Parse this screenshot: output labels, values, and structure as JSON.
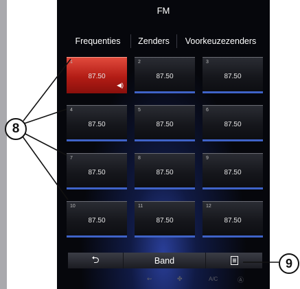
{
  "screen": {
    "title": "FM",
    "tabs": [
      "Frequenties",
      "Zenders",
      "Voorkeuzezenders"
    ]
  },
  "presets": [
    {
      "number": "1",
      "frequency": "87.50",
      "active": true,
      "playing_icon": "speaker-icon"
    },
    {
      "number": "2",
      "frequency": "87.50",
      "active": false
    },
    {
      "number": "3",
      "frequency": "87.50",
      "active": false
    },
    {
      "number": "4",
      "frequency": "87.50",
      "active": false
    },
    {
      "number": "5",
      "frequency": "87.50",
      "active": false
    },
    {
      "number": "6",
      "frequency": "87.50",
      "active": false
    },
    {
      "number": "7",
      "frequency": "87.50",
      "active": false
    },
    {
      "number": "8",
      "frequency": "87.50",
      "active": false
    },
    {
      "number": "9",
      "frequency": "87.50",
      "active": false
    },
    {
      "number": "10",
      "frequency": "87.50",
      "active": false
    },
    {
      "number": "11",
      "frequency": "87.50",
      "active": false
    },
    {
      "number": "12",
      "frequency": "87.50",
      "active": false
    }
  ],
  "bottom_bar": {
    "back_icon": "back-arrow-icon",
    "back_glyph": "⮌",
    "band_label": "Band",
    "list_icon": "list-document-icon"
  },
  "bottom_icons": [
    {
      "name": "seat-climate-icon",
      "glyph": "⇜"
    },
    {
      "name": "fan-icon",
      "glyph": "✤"
    },
    {
      "name": "ac-label",
      "glyph": "A/C"
    },
    {
      "name": "auto-climate-icon",
      "glyph": "Ⓐ"
    }
  ],
  "callouts": {
    "eight": "8",
    "nine": "9"
  },
  "colors": {
    "active_preset": "#c8281e",
    "preset_underline": "#3f63c8",
    "screen_bg": "#06070c"
  }
}
